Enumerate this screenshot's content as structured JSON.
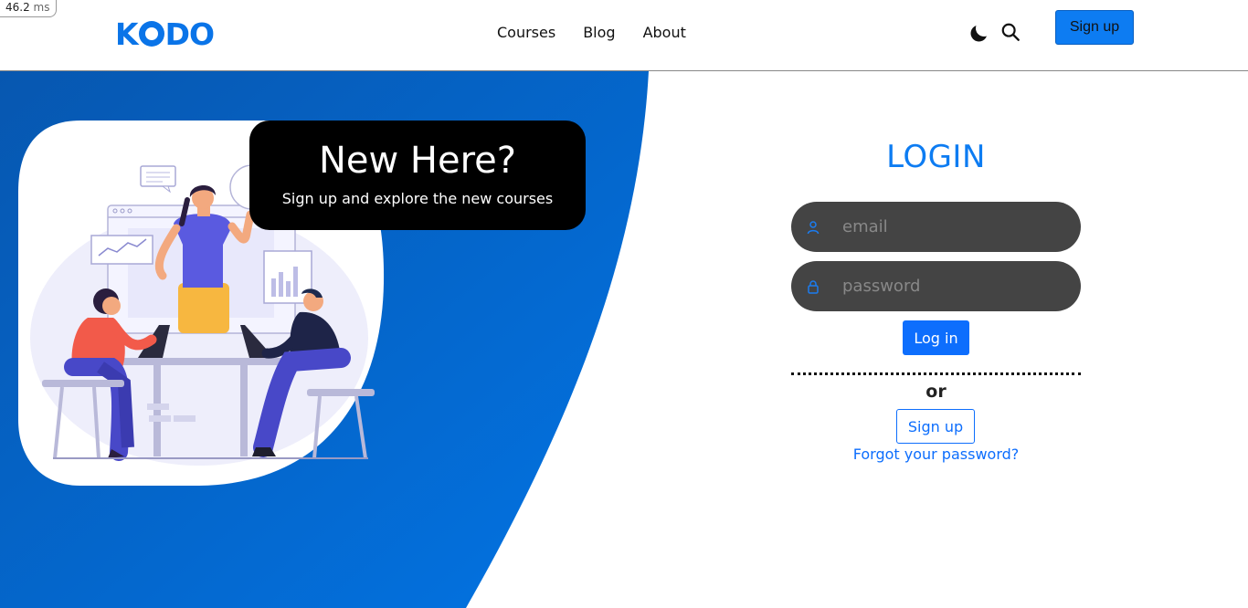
{
  "perf": {
    "value": "46.2",
    "unit": "ms"
  },
  "brand": {
    "logo_text": "KODO",
    "logo_before": "K",
    "logo_after": "DO",
    "color": "#0a74e8"
  },
  "nav": {
    "items": [
      {
        "label": "Courses"
      },
      {
        "label": "Blog"
      },
      {
        "label": "About"
      }
    ]
  },
  "header": {
    "theme_icon": "moon-icon",
    "search_icon": "search-icon",
    "signup_label": "Sign up"
  },
  "hero": {
    "title": "New Here?",
    "subtitle": "Sign up and explore the new courses",
    "bg_color": "#0a6fd8"
  },
  "login": {
    "title": "LOGIN",
    "email_placeholder": "email",
    "password_placeholder": "password",
    "login_label": "Log in",
    "or_label": "or",
    "signup_label": "Sign up",
    "forgot_label": "Forgot your password?",
    "accent": "#0d6efd"
  }
}
